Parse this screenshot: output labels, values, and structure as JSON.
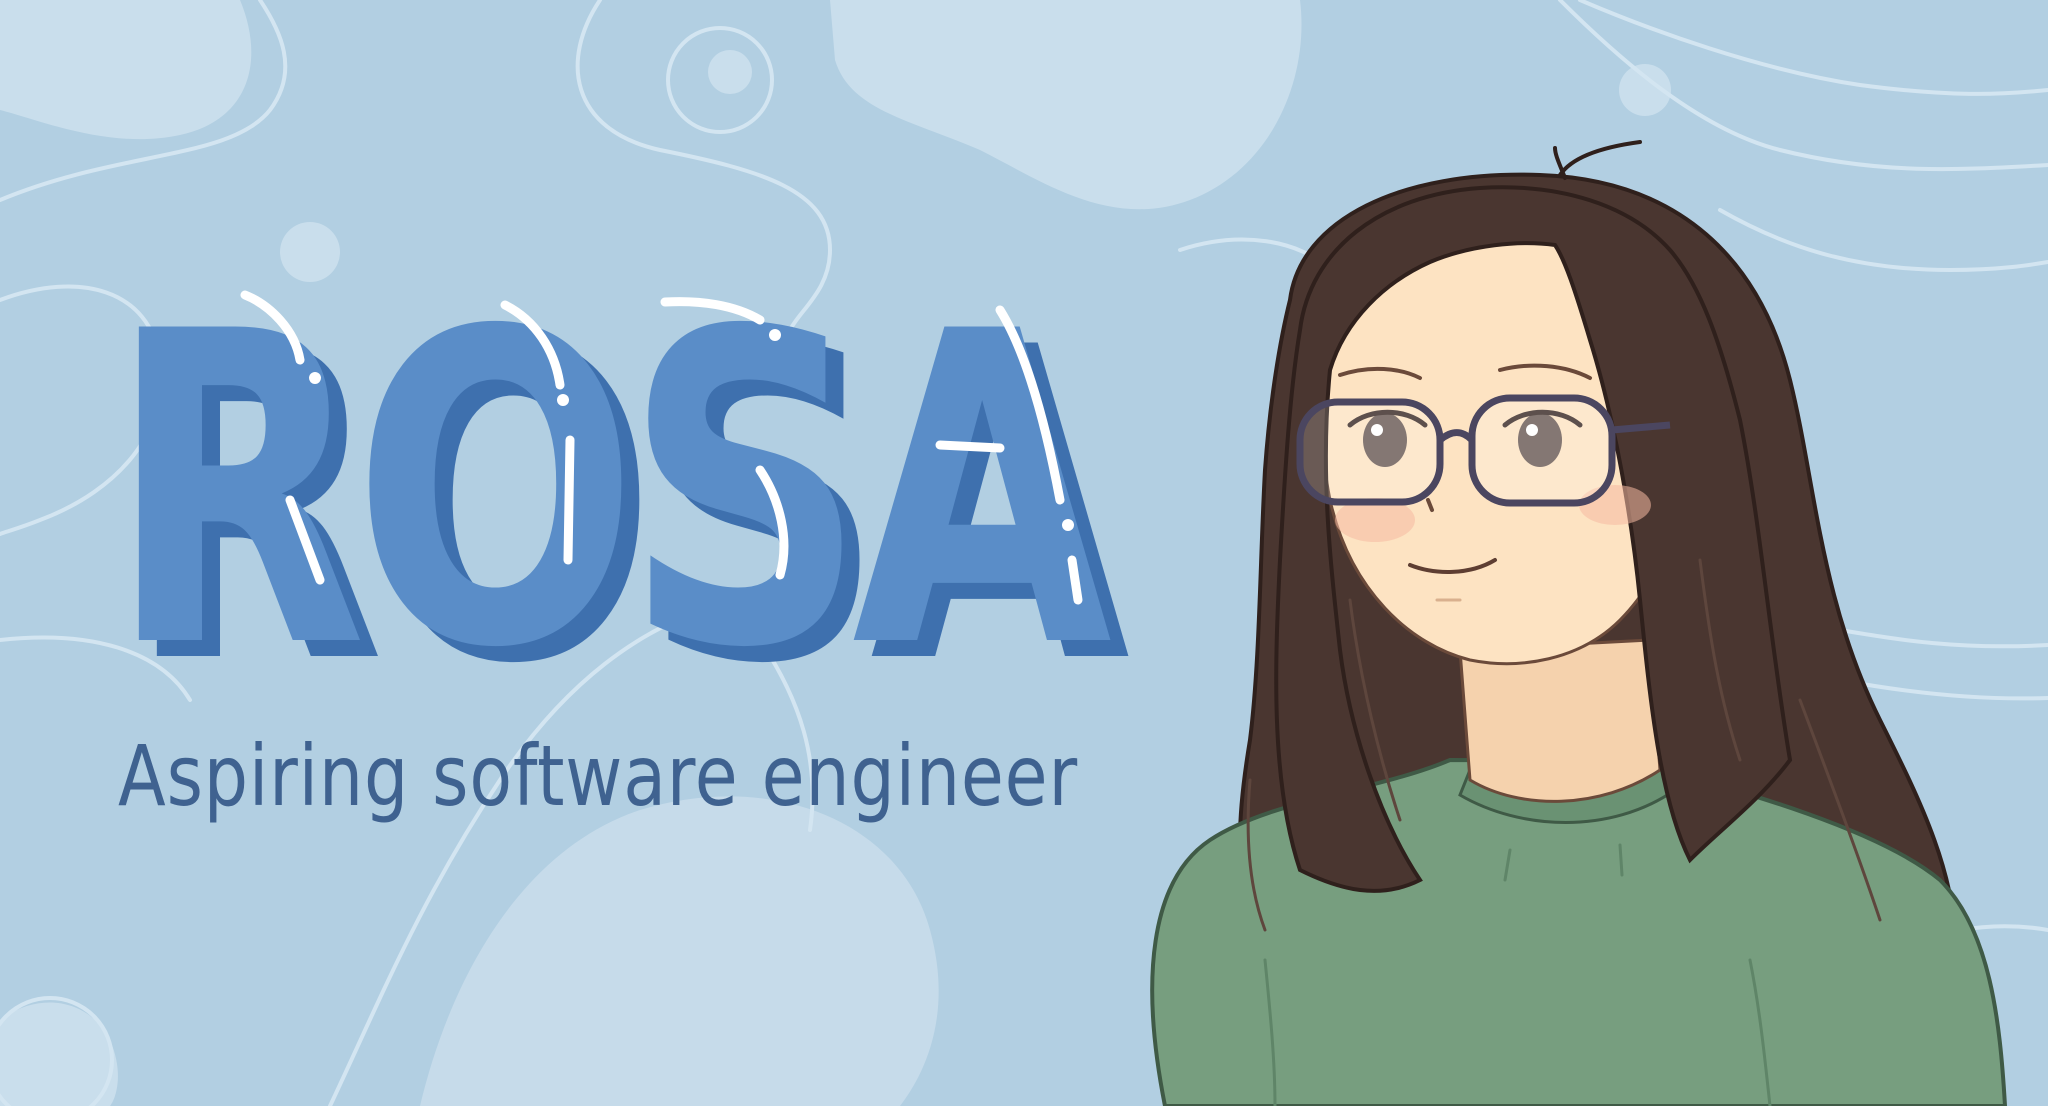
{
  "banner": {
    "name": "ROSA",
    "tagline": "Aspiring software engineer"
  },
  "colors": {
    "background": "#b2cfe2",
    "blob_light": "#cadfed",
    "title_fill": "#5a8dc8",
    "title_shadow": "#3e70ae",
    "tagline": "#3f6290",
    "hair": "#4a3630",
    "skin": "#fde3c2",
    "sweater": "#779e7f"
  }
}
